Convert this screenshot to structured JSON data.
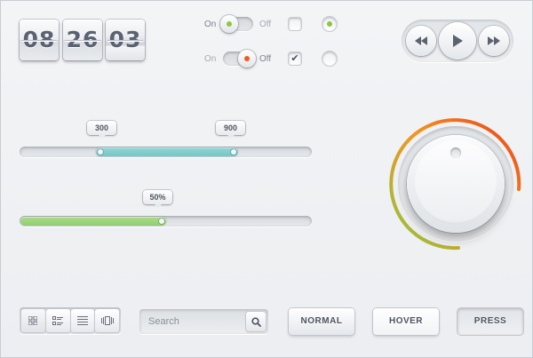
{
  "clock": {
    "digits": [
      "08",
      "26",
      "03"
    ]
  },
  "toggles": [
    {
      "on_label": "On",
      "off_label": "Off",
      "state": "on",
      "led_color": "#8dc63f"
    },
    {
      "on_label": "On",
      "off_label": "Off",
      "state": "off",
      "led_color": "#f15a24"
    }
  ],
  "checkboxes": [
    {
      "checked": false,
      "glyph": ""
    },
    {
      "checked": true,
      "glyph": "✔"
    }
  ],
  "radios": [
    {
      "selected": true,
      "dot_color": "#8dc63f"
    },
    {
      "selected": false
    }
  ],
  "media": {
    "buttons": [
      "rewind-icon",
      "play-icon",
      "fast-forward-icon"
    ]
  },
  "range_slider": {
    "low_label": "300",
    "high_label": "900",
    "fill_color": "#8fd6d7"
  },
  "progress_slider": {
    "label": "50%",
    "value": 0.5,
    "fill_color": "#a9dc8a"
  },
  "dial": {
    "gradient": [
      "#8dc63f",
      "#f7931e",
      "#e8401c"
    ]
  },
  "view_switcher": {
    "icons": [
      "grid-view-icon",
      "detail-list-icon",
      "list-view-icon",
      "cover-flow-icon"
    ]
  },
  "search": {
    "placeholder": "Search",
    "icon": "magnifier-icon"
  },
  "buttons": {
    "normal": "NORMAL",
    "hover": "HOVER",
    "press": "PRESS"
  }
}
